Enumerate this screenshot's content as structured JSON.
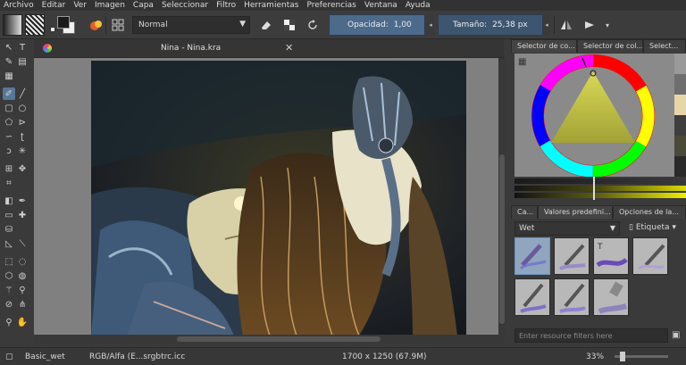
{
  "menu": [
    "Archivo",
    "Editar",
    "Ver",
    "Imagen",
    "Capa",
    "Seleccionar",
    "Filtro",
    "Herramientas",
    "Preferencias",
    "Ventana",
    "Ayuda"
  ],
  "toolbar": {
    "blend_mode": "Normal",
    "opacity_label": "Opacidad:",
    "opacity_value": "1,00",
    "size_label": "Tamaño:",
    "size_value": "25,38 px"
  },
  "document": {
    "tab_title": "Nina - Nina.kra"
  },
  "docker": {
    "top_tabs": [
      "Selector de co...",
      "Selector de col...",
      "Select..."
    ],
    "bottom_tabs": [
      "Ca...",
      "Valores predefini...",
      "Opciones de la..."
    ],
    "preset_group": "Wet",
    "tag_label": "Etiqueta",
    "filter_placeholder": "Enter resource filters here"
  },
  "status": {
    "brush": "Basic_wet",
    "color_profile": "RGB/Alfa (E...srgbtrc.icc",
    "dimensions": "1700 x 1250 (67.9M)",
    "zoom": "33%"
  },
  "colors": {
    "accent": "#56779a",
    "slider": "#4c6a8a",
    "panel_bg": "#3a3a3a"
  }
}
